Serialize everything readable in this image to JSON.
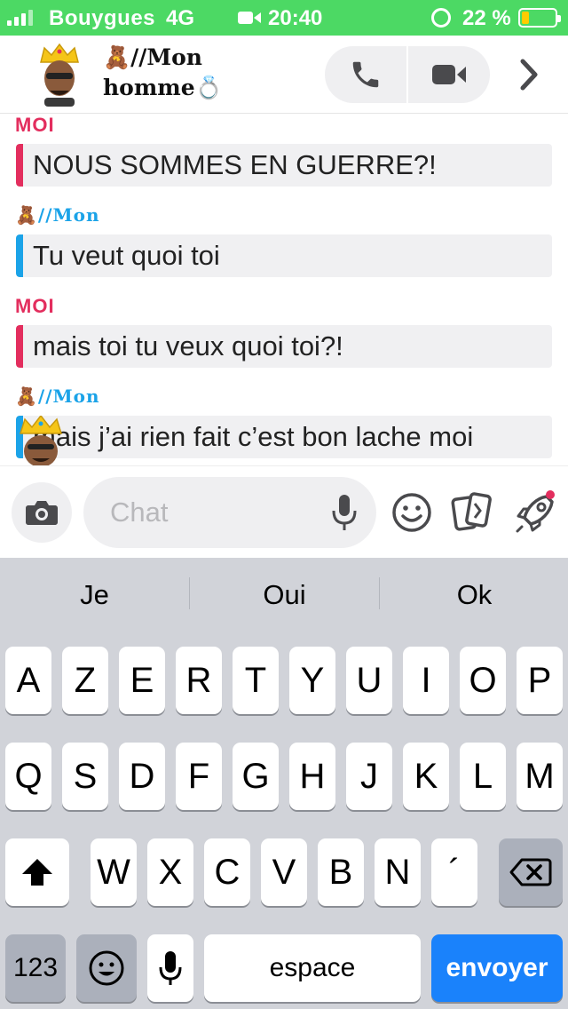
{
  "status": {
    "carrier": "Bouygues",
    "network": "4G",
    "time": "20:40",
    "battery": "22 %",
    "battery_level": 0.22,
    "battery_color": "#ffcc00",
    "bar_color": "#4cd964"
  },
  "header": {
    "contact_name": "🧸//Mon homme💍",
    "call_icon": "phone-icon",
    "video_icon": "video-camera-icon",
    "next_icon": "chevron-right-icon"
  },
  "messages": [
    {
      "sender": "MOI",
      "side": "me",
      "text": "NOUS SOMMES EN GUERRE?!"
    },
    {
      "sender": "🧸//Mon",
      "side": "him",
      "text": "Tu veut quoi toi"
    },
    {
      "sender": "MOI",
      "side": "me",
      "text": "mais toi tu veux quoi toi?!"
    },
    {
      "sender": "🧸//Mon",
      "side": "him",
      "text": "mais j’ai rien fait c’est bon lache moi"
    }
  ],
  "composer": {
    "placeholder": "Chat"
  },
  "keyboard": {
    "suggestions": [
      "Je",
      "Oui",
      "Ok"
    ],
    "row1": [
      "A",
      "Z",
      "E",
      "R",
      "T",
      "Y",
      "U",
      "I",
      "O",
      "P"
    ],
    "row2": [
      "Q",
      "S",
      "D",
      "F",
      "G",
      "H",
      "J",
      "K",
      "L",
      "M"
    ],
    "row3": [
      "W",
      "X",
      "C",
      "V",
      "B",
      "N",
      "´"
    ],
    "numbers_key": "123",
    "space_key": "espace",
    "send_key": "envoyer"
  },
  "colors": {
    "me": "#e32e5e",
    "him": "#1ba3e8",
    "send": "#1a82fb"
  }
}
